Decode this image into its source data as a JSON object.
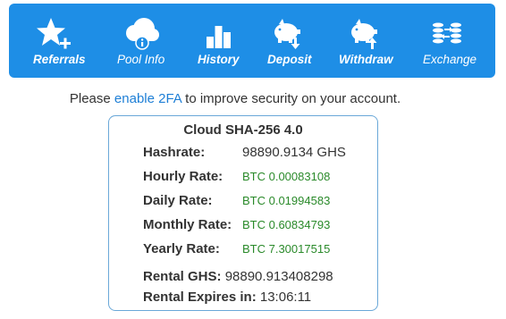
{
  "nav": {
    "referrals": {
      "label": "Referrals",
      "icon": "star-plus-icon"
    },
    "pool_info": {
      "label": "Pool Info",
      "icon": "cloud-info-icon"
    },
    "history": {
      "label": "History",
      "icon": "bar-chart-icon"
    },
    "deposit": {
      "label": "Deposit",
      "icon": "piggy-bank-down-icon"
    },
    "withdraw": {
      "label": "Withdraw",
      "icon": "piggy-bank-up-icon"
    },
    "exchange": {
      "label": "Exchange",
      "icon": "coin-exchange-icon"
    }
  },
  "notice": {
    "prefix": "Please",
    "link": "enable 2FA",
    "suffix": "to improve security on your account."
  },
  "card": {
    "title": "Cloud SHA-256 4.0",
    "hashrate_label": "Hashrate:",
    "hashrate_value": "98890.9134 GHS",
    "hourly_label": "Hourly Rate:",
    "hourly_value": "BTC 0.00083108",
    "daily_label": "Daily Rate:",
    "daily_value": "BTC 0.01994583",
    "monthly_label": "Monthly Rate:",
    "monthly_value": "BTC 0.60834793",
    "yearly_label": "Yearly Rate:",
    "yearly_value": "BTC 7.30017515",
    "rental_ghs_label": "Rental GHS:",
    "rental_ghs_value": "98890.913408298",
    "rental_expires_label": "Rental Expires in:",
    "rental_expires_value": "13:06:11"
  },
  "colors": {
    "nav_bg": "#1e8ee6",
    "link": "#1e7fd6",
    "rate_green": "#2a8a2a",
    "card_border": "#6aa8d8"
  }
}
